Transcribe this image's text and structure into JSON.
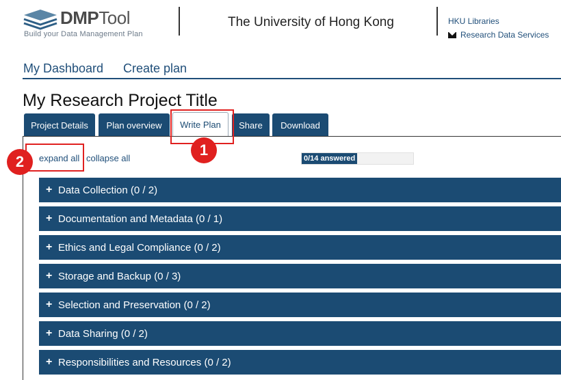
{
  "header": {
    "logo_name": "DMP",
    "logo_name_suffix": "Tool",
    "tagline": "Build your Data Management Plan",
    "institution": "The University of Hong Kong",
    "links": [
      "HKU Libraries",
      "Research Data Services"
    ]
  },
  "nav": {
    "dashboard": "My Dashboard",
    "create_plan": "Create plan"
  },
  "page_title": "My Research Project Title",
  "tabs": [
    {
      "label": "Project Details",
      "active": false
    },
    {
      "label": "Plan overview",
      "active": false
    },
    {
      "label": "Write Plan",
      "active": true
    },
    {
      "label": "Share",
      "active": false
    },
    {
      "label": "Download",
      "active": false
    }
  ],
  "controls": {
    "expand_all": "expand all",
    "separator": "|",
    "collapse_all": "collapse all"
  },
  "progress": {
    "label": "0/14 answered",
    "answered": 0,
    "total": 14
  },
  "sections": [
    {
      "title": "Data Collection (0 / 2)"
    },
    {
      "title": "Documentation and Metadata (0 / 1)"
    },
    {
      "title": "Ethics and Legal Compliance (0 / 2)"
    },
    {
      "title": "Storage and Backup (0 / 3)"
    },
    {
      "title": "Selection and Preservation (0 / 2)"
    },
    {
      "title": "Data Sharing (0 / 2)"
    },
    {
      "title": "Responsibilities and Resources (0 / 2)"
    }
  ],
  "annotations": {
    "badge1": "1",
    "badge2": "2"
  },
  "colors": {
    "primary": "#1b4b73",
    "annotation_red": "#e0201f"
  },
  "icons": {
    "mail": "envelope-icon",
    "expand": "plus-icon"
  }
}
